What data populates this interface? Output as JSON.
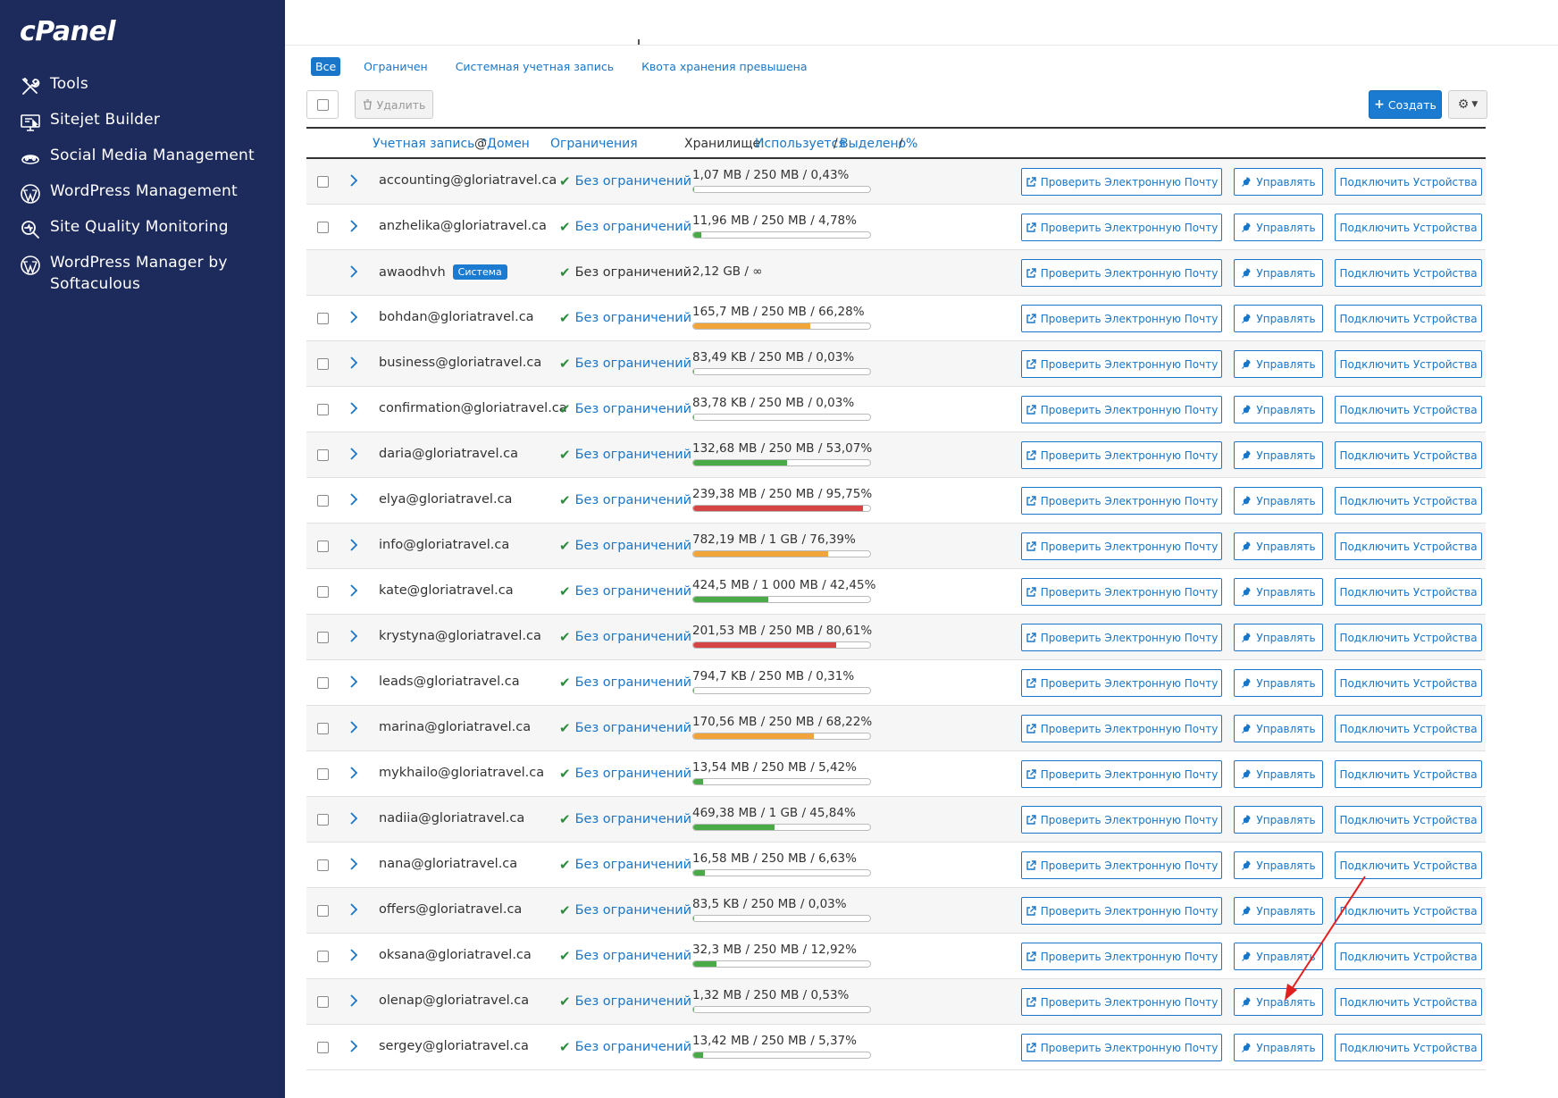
{
  "brand": {
    "logo_text": "cPanel"
  },
  "sidebar": {
    "items": [
      {
        "label": "Tools",
        "icon": "tools-icon"
      },
      {
        "label": "Sitejet Builder",
        "icon": "sitejet-icon"
      },
      {
        "label": "Social Media Management",
        "icon": "social-media-icon"
      },
      {
        "label": "WordPress Management",
        "icon": "wordpress-icon"
      },
      {
        "label": "Site Quality Monitoring",
        "icon": "magnifier-icon"
      },
      {
        "label": "WordPress Manager by Softaculous",
        "icon": "wordpress-icon"
      }
    ]
  },
  "filters": [
    {
      "label": "Все",
      "active": true
    },
    {
      "label": "Ограничен",
      "active": false
    },
    {
      "label": "Системная учетная запись",
      "active": false
    },
    {
      "label": "Квота хранения превышена",
      "active": false
    }
  ],
  "toolbar": {
    "delete_label": "Удалить",
    "create_label": "Создать"
  },
  "table": {
    "headers": {
      "account": "Учетная запись",
      "at": "@",
      "domain": "Домен",
      "restrictions": "Ограничения",
      "storage": "Хранилище:",
      "used": "Используется",
      "sep1": "/",
      "allocated": "Выделено",
      "sep2": "/",
      "percent": "%"
    },
    "actions": {
      "check_email": "Проверить Электронную Почту",
      "manage": "Управлять",
      "connect_devices": "Подключить Устройства"
    },
    "system_badge": "Система",
    "rows": [
      {
        "account": "accounting@gloriatravel.ca",
        "restriction": "Без ограничений",
        "usage": "1,07 MB / 250 MB / 0,43%",
        "percent": 0.43,
        "level": "green",
        "system": false
      },
      {
        "account": "anzhelika@gloriatravel.ca",
        "restriction": "Без ограничений",
        "usage": "11,96 MB / 250 MB / 4,78%",
        "percent": 4.78,
        "level": "green",
        "system": false
      },
      {
        "account": "awaodhvh",
        "restriction": "Без ограничений",
        "usage": "2,12 GB / ∞",
        "percent": null,
        "level": "none",
        "system": true
      },
      {
        "account": "bohdan@gloriatravel.ca",
        "restriction": "Без ограничений",
        "usage": "165,7 MB / 250 MB / 66,28%",
        "percent": 66.28,
        "level": "orange",
        "system": false
      },
      {
        "account": "business@gloriatravel.ca",
        "restriction": "Без ограничений",
        "usage": "83,49 KB / 250 MB / 0,03%",
        "percent": 0.03,
        "level": "green",
        "system": false
      },
      {
        "account": "confirmation@gloriatravel.ca",
        "restriction": "Без ограничений",
        "usage": "83,78 KB / 250 MB / 0,03%",
        "percent": 0.03,
        "level": "green",
        "system": false
      },
      {
        "account": "daria@gloriatravel.ca",
        "restriction": "Без ограничений",
        "usage": "132,68 MB / 250 MB / 53,07%",
        "percent": 53.07,
        "level": "green",
        "system": false
      },
      {
        "account": "elya@gloriatravel.ca",
        "restriction": "Без ограничений",
        "usage": "239,38 MB / 250 MB / 95,75%",
        "percent": 95.75,
        "level": "red",
        "system": false
      },
      {
        "account": "info@gloriatravel.ca",
        "restriction": "Без ограничений",
        "usage": "782,19 MB / 1 GB / 76,39%",
        "percent": 76.39,
        "level": "orange",
        "system": false
      },
      {
        "account": "kate@gloriatravel.ca",
        "restriction": "Без ограничений",
        "usage": "424,5 MB / 1 000 MB / 42,45%",
        "percent": 42.45,
        "level": "green",
        "system": false
      },
      {
        "account": "krystyna@gloriatravel.ca",
        "restriction": "Без ограничений",
        "usage": "201,53 MB / 250 MB / 80,61%",
        "percent": 80.61,
        "level": "red",
        "system": false
      },
      {
        "account": "leads@gloriatravel.ca",
        "restriction": "Без ограничений",
        "usage": "794,7 KB / 250 MB / 0,31%",
        "percent": 0.31,
        "level": "green",
        "system": false
      },
      {
        "account": "marina@gloriatravel.ca",
        "restriction": "Без ограничений",
        "usage": "170,56 MB / 250 MB / 68,22%",
        "percent": 68.22,
        "level": "orange",
        "system": false
      },
      {
        "account": "mykhailo@gloriatravel.ca",
        "restriction": "Без ограничений",
        "usage": "13,54 MB / 250 MB / 5,42%",
        "percent": 5.42,
        "level": "green",
        "system": false
      },
      {
        "account": "nadiia@gloriatravel.ca",
        "restriction": "Без ограничений",
        "usage": "469,38 MB / 1 GB / 45,84%",
        "percent": 45.84,
        "level": "green",
        "system": false
      },
      {
        "account": "nana@gloriatravel.ca",
        "restriction": "Без ограничений",
        "usage": "16,58 MB / 250 MB / 6,63%",
        "percent": 6.63,
        "level": "green",
        "system": false
      },
      {
        "account": "offers@gloriatravel.ca",
        "restriction": "Без ограничений",
        "usage": "83,5 KB / 250 MB / 0,03%",
        "percent": 0.03,
        "level": "green",
        "system": false
      },
      {
        "account": "oksana@gloriatravel.ca",
        "restriction": "Без ограничений",
        "usage": "32,3 MB / 250 MB / 12,92%",
        "percent": 12.92,
        "level": "green",
        "system": false
      },
      {
        "account": "olenap@gloriatravel.ca",
        "restriction": "Без ограничений",
        "usage": "1,32 MB / 250 MB / 0,53%",
        "percent": 0.53,
        "level": "green",
        "system": false
      },
      {
        "account": "sergey@gloriatravel.ca",
        "restriction": "Без ограничений",
        "usage": "13,42 MB / 250 MB / 5,37%",
        "percent": 5.37,
        "level": "green",
        "system": false
      }
    ]
  },
  "colors": {
    "sidebar_bg": "#1d2a5c",
    "accent": "#1976c8",
    "ok_green": "#2e8b3e",
    "bar_green": "#4aaa48",
    "bar_orange": "#f0a43a",
    "bar_red": "#d64545",
    "annotation_arrow": "#e02020"
  }
}
